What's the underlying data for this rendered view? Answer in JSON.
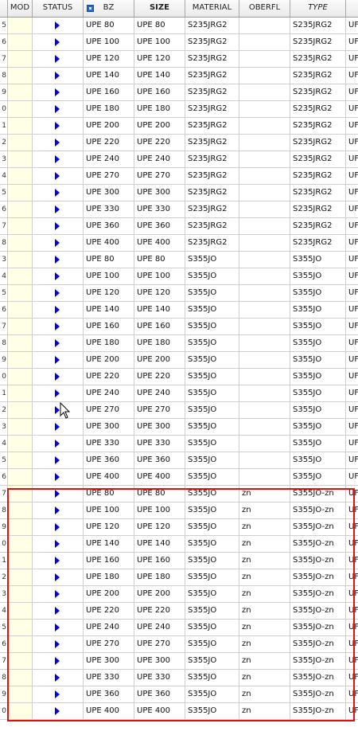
{
  "columns": {
    "mod": "MOD",
    "status": "STATUS",
    "bz": "BZ",
    "size": "SIZE",
    "material": "MATERIAL",
    "oberfl": "OBERFL",
    "type": "TYPE"
  },
  "rows": [
    {
      "idx": "5",
      "bz": "UPE 80",
      "size": "UPE 80",
      "material": "S235JRG2",
      "oberfl": "",
      "type": "S235JRG2",
      "extra": "UF"
    },
    {
      "idx": "6",
      "bz": "UPE 100",
      "size": "UPE 100",
      "material": "S235JRG2",
      "oberfl": "",
      "type": "S235JRG2",
      "extra": "UF"
    },
    {
      "idx": "7",
      "bz": "UPE 120",
      "size": "UPE 120",
      "material": "S235JRG2",
      "oberfl": "",
      "type": "S235JRG2",
      "extra": "UF"
    },
    {
      "idx": "8",
      "bz": "UPE 140",
      "size": "UPE 140",
      "material": "S235JRG2",
      "oberfl": "",
      "type": "S235JRG2",
      "extra": "UF"
    },
    {
      "idx": "9",
      "bz": "UPE 160",
      "size": "UPE 160",
      "material": "S235JRG2",
      "oberfl": "",
      "type": "S235JRG2",
      "extra": "UF"
    },
    {
      "idx": "0",
      "bz": "UPE 180",
      "size": "UPE 180",
      "material": "S235JRG2",
      "oberfl": "",
      "type": "S235JRG2",
      "extra": "UF"
    },
    {
      "idx": "1",
      "bz": "UPE 200",
      "size": "UPE 200",
      "material": "S235JRG2",
      "oberfl": "",
      "type": "S235JRG2",
      "extra": "UF"
    },
    {
      "idx": "2",
      "bz": "UPE 220",
      "size": "UPE 220",
      "material": "S235JRG2",
      "oberfl": "",
      "type": "S235JRG2",
      "extra": "UF"
    },
    {
      "idx": "3",
      "bz": "UPE 240",
      "size": "UPE 240",
      "material": "S235JRG2",
      "oberfl": "",
      "type": "S235JRG2",
      "extra": "UF"
    },
    {
      "idx": "4",
      "bz": "UPE 270",
      "size": "UPE 270",
      "material": "S235JRG2",
      "oberfl": "",
      "type": "S235JRG2",
      "extra": "UF"
    },
    {
      "idx": "5",
      "bz": "UPE 300",
      "size": "UPE 300",
      "material": "S235JRG2",
      "oberfl": "",
      "type": "S235JRG2",
      "extra": "UF"
    },
    {
      "idx": "6",
      "bz": "UPE 330",
      "size": "UPE 330",
      "material": "S235JRG2",
      "oberfl": "",
      "type": "S235JRG2",
      "extra": "UF"
    },
    {
      "idx": "7",
      "bz": "UPE 360",
      "size": "UPE 360",
      "material": "S235JRG2",
      "oberfl": "",
      "type": "S235JRG2",
      "extra": "UF"
    },
    {
      "idx": "8",
      "bz": "UPE 400",
      "size": "UPE 400",
      "material": "S235JRG2",
      "oberfl": "",
      "type": "S235JRG2",
      "extra": "UF"
    },
    {
      "idx": "3",
      "bz": "UPE 80",
      "size": "UPE 80",
      "material": "S355JO",
      "oberfl": "",
      "type": "S355JO",
      "extra": "UF"
    },
    {
      "idx": "4",
      "bz": "UPE 100",
      "size": "UPE 100",
      "material": "S355JO",
      "oberfl": "",
      "type": "S355JO",
      "extra": "UF"
    },
    {
      "idx": "5",
      "bz": "UPE 120",
      "size": "UPE 120",
      "material": "S355JO",
      "oberfl": "",
      "type": "S355JO",
      "extra": "UF"
    },
    {
      "idx": "6",
      "bz": "UPE 140",
      "size": "UPE 140",
      "material": "S355JO",
      "oberfl": "",
      "type": "S355JO",
      "extra": "UF"
    },
    {
      "idx": "7",
      "bz": "UPE 160",
      "size": "UPE 160",
      "material": "S355JO",
      "oberfl": "",
      "type": "S355JO",
      "extra": "UF"
    },
    {
      "idx": "8",
      "bz": "UPE 180",
      "size": "UPE 180",
      "material": "S355JO",
      "oberfl": "",
      "type": "S355JO",
      "extra": "UF"
    },
    {
      "idx": "9",
      "bz": "UPE 200",
      "size": "UPE 200",
      "material": "S355JO",
      "oberfl": "",
      "type": "S355JO",
      "extra": "UF"
    },
    {
      "idx": "0",
      "bz": "UPE 220",
      "size": "UPE 220",
      "material": "S355JO",
      "oberfl": "",
      "type": "S355JO",
      "extra": "UF"
    },
    {
      "idx": "1",
      "bz": "UPE 240",
      "size": "UPE 240",
      "material": "S355JO",
      "oberfl": "",
      "type": "S355JO",
      "extra": "UF"
    },
    {
      "idx": "2",
      "bz": "UPE 270",
      "size": "UPE 270",
      "material": "S355JO",
      "oberfl": "",
      "type": "S355JO",
      "extra": "UF"
    },
    {
      "idx": "3",
      "bz": "UPE 300",
      "size": "UPE 300",
      "material": "S355JO",
      "oberfl": "",
      "type": "S355JO",
      "extra": "UF"
    },
    {
      "idx": "4",
      "bz": "UPE 330",
      "size": "UPE 330",
      "material": "S355JO",
      "oberfl": "",
      "type": "S355JO",
      "extra": "UF"
    },
    {
      "idx": "5",
      "bz": "UPE 360",
      "size": "UPE 360",
      "material": "S355JO",
      "oberfl": "",
      "type": "S355JO",
      "extra": "UF"
    },
    {
      "idx": "6",
      "bz": "UPE 400",
      "size": "UPE 400",
      "material": "S355JO",
      "oberfl": "",
      "type": "S355JO",
      "extra": "UF"
    },
    {
      "idx": "7",
      "bz": "UPE 80",
      "size": "UPE 80",
      "material": "S355JO",
      "oberfl": "zn",
      "type": "S355JO-zn",
      "extra": "UF"
    },
    {
      "idx": "8",
      "bz": "UPE 100",
      "size": "UPE 100",
      "material": "S355JO",
      "oberfl": "zn",
      "type": "S355JO-zn",
      "extra": "UF"
    },
    {
      "idx": "9",
      "bz": "UPE 120",
      "size": "UPE 120",
      "material": "S355JO",
      "oberfl": "zn",
      "type": "S355JO-zn",
      "extra": "UF"
    },
    {
      "idx": "0",
      "bz": "UPE 140",
      "size": "UPE 140",
      "material": "S355JO",
      "oberfl": "zn",
      "type": "S355JO-zn",
      "extra": "UF"
    },
    {
      "idx": "1",
      "bz": "UPE 160",
      "size": "UPE 160",
      "material": "S355JO",
      "oberfl": "zn",
      "type": "S355JO-zn",
      "extra": "UF"
    },
    {
      "idx": "2",
      "bz": "UPE 180",
      "size": "UPE 180",
      "material": "S355JO",
      "oberfl": "zn",
      "type": "S355JO-zn",
      "extra": "UF"
    },
    {
      "idx": "3",
      "bz": "UPE 200",
      "size": "UPE 200",
      "material": "S355JO",
      "oberfl": "zn",
      "type": "S355JO-zn",
      "extra": "UF"
    },
    {
      "idx": "4",
      "bz": "UPE 220",
      "size": "UPE 220",
      "material": "S355JO",
      "oberfl": "zn",
      "type": "S355JO-zn",
      "extra": "UF"
    },
    {
      "idx": "5",
      "bz": "UPE 240",
      "size": "UPE 240",
      "material": "S355JO",
      "oberfl": "zn",
      "type": "S355JO-zn",
      "extra": "UF"
    },
    {
      "idx": "6",
      "bz": "UPE 270",
      "size": "UPE 270",
      "material": "S355JO",
      "oberfl": "zn",
      "type": "S355JO-zn",
      "extra": "UF"
    },
    {
      "idx": "7",
      "bz": "UPE 300",
      "size": "UPE 300",
      "material": "S355JO",
      "oberfl": "zn",
      "type": "S355JO-zn",
      "extra": "UF"
    },
    {
      "idx": "8",
      "bz": "UPE 330",
      "size": "UPE 330",
      "material": "S355JO",
      "oberfl": "zn",
      "type": "S355JO-zn",
      "extra": "UF"
    },
    {
      "idx": "9",
      "bz": "UPE 360",
      "size": "UPE 360",
      "material": "S355JO",
      "oberfl": "zn",
      "type": "S355JO-zn",
      "extra": "UF"
    },
    {
      "idx": "0",
      "bz": "UPE 400",
      "size": "UPE 400",
      "material": "S355JO",
      "oberfl": "zn",
      "type": "S355JO-zn",
      "extra": "UF"
    }
  ],
  "status_icon": "play-triangle-icon",
  "colors": {
    "status_icon": "#0000ee",
    "mod_column_bg": "#ffffe6",
    "highlight_border": "#e01010"
  }
}
